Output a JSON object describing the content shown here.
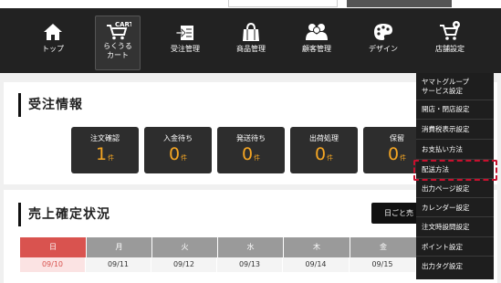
{
  "nav": {
    "items": [
      {
        "label": "トップ",
        "icon": "home-icon"
      },
      {
        "label": "らくうる\nカート",
        "icon": "cart-icon",
        "badge": "CART"
      },
      {
        "label": "受注管理",
        "icon": "order-icon"
      },
      {
        "label": "商品管理",
        "icon": "bag-icon"
      },
      {
        "label": "顧客管理",
        "icon": "users-icon"
      },
      {
        "label": "デザイン",
        "icon": "design-icon"
      },
      {
        "label": "店舗設定",
        "icon": "shop-settings-icon"
      }
    ]
  },
  "orders": {
    "title": "受注情報",
    "stats": [
      {
        "label": "注文確認",
        "value": "1",
        "unit": "件"
      },
      {
        "label": "入金待ち",
        "value": "0",
        "unit": "件"
      },
      {
        "label": "発送待ち",
        "value": "0",
        "unit": "件"
      },
      {
        "label": "出荷処理",
        "value": "0",
        "unit": "件"
      },
      {
        "label": "保留",
        "value": "0",
        "unit": "件"
      }
    ]
  },
  "sales": {
    "title": "売上確定状況",
    "day_button": "日ごと売",
    "weekdays": [
      "日",
      "月",
      "火",
      "水",
      "木",
      "金"
    ],
    "dates": [
      "09/10",
      "09/11",
      "09/12",
      "09/13",
      "09/14",
      "09/15"
    ]
  },
  "dropdown": {
    "items": [
      "ヤマトグループ\nサービス設定",
      "開店・閉店設定",
      "消費税表示設定",
      "お支払い方法",
      "配送方法",
      "出力ページ設定",
      "カレンダー設定",
      "注文時設問設定",
      "ポイント設定",
      "出力タグ設定"
    ],
    "highlighted": "配送方法"
  },
  "colors": {
    "nav_bg": "#222222",
    "accent_orange": "#f5a623",
    "sunday_red": "#d9534f",
    "weekday_gray": "#9a9a9a",
    "highlight_red": "#c8102e"
  }
}
